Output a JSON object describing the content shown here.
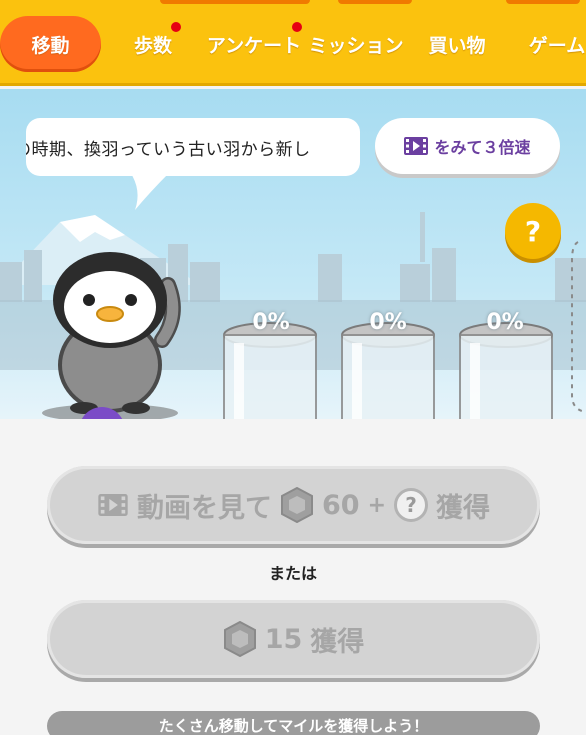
{
  "tabs": [
    {
      "label": "移動",
      "active": true,
      "badge": false
    },
    {
      "label": "歩数",
      "active": false,
      "badge": true
    },
    {
      "label": "アンケート",
      "active": false,
      "badge": true
    },
    {
      "label": "ミッション",
      "active": false,
      "badge": false
    },
    {
      "label": "買い物",
      "active": false,
      "badge": false
    },
    {
      "label": "ゲーム",
      "active": false,
      "badge": false
    }
  ],
  "bubble": {
    "text": "の時期、換羽っていう古い羽から新し"
  },
  "speed_button": {
    "label": "をみて３倍速",
    "icon": "video-icon"
  },
  "help_badge": {
    "label": "?"
  },
  "capsules": [
    {
      "progress_percent": 0,
      "label": "0%"
    },
    {
      "progress_percent": 0,
      "label": "0%"
    },
    {
      "progress_percent": 0,
      "label": "0%"
    }
  ],
  "penguin": {
    "badge_icon": "tshirt-icon"
  },
  "video_reward_button": {
    "label": "動画を見て",
    "amount": "60",
    "plus": "+",
    "action": "獲得",
    "icons": [
      "video-icon",
      "gem-icon",
      "question-circle-icon"
    ]
  },
  "or_label": "または",
  "gem_reward_button": {
    "amount": "15",
    "action": "獲得",
    "icon": "gem-icon"
  },
  "hint_bar": {
    "text": "たくさん移動してマイルを獲得しよう！"
  },
  "colors": {
    "tab_bar": "#fbc20e",
    "active_tab": "#ff6a1f",
    "accent_purple": "#6b3fa0",
    "badge": "#e60012",
    "disabled_button": "#d3d3d3"
  }
}
